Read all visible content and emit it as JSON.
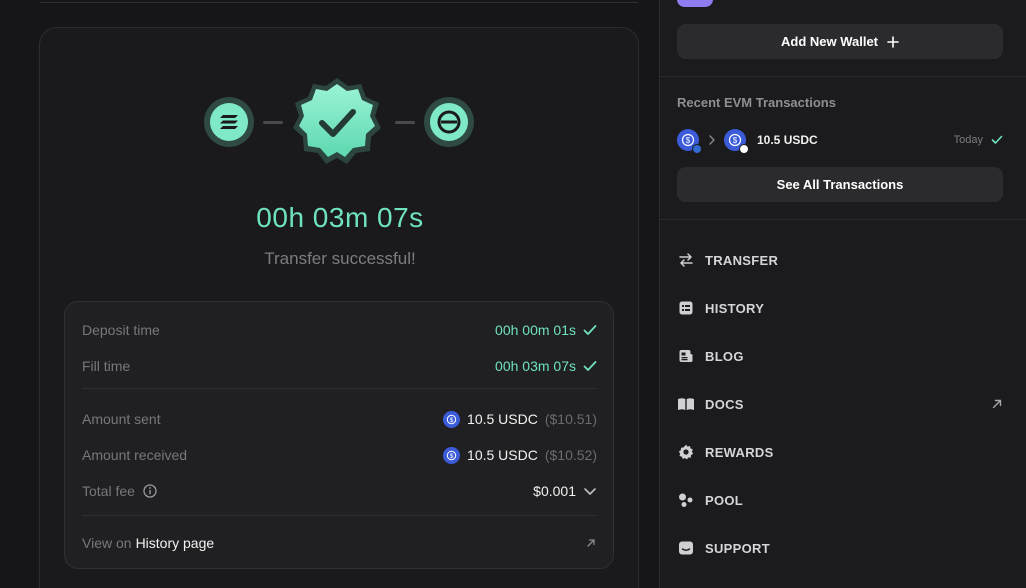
{
  "transfer": {
    "timer": "00h 03m 07s",
    "status": "Transfer successful!",
    "details": {
      "deposit_label": "Deposit time",
      "deposit_value": "00h 00m 01s",
      "fill_label": "Fill time",
      "fill_value": "00h 03m 07s",
      "sent_label": "Amount sent",
      "sent_value": "10.5 USDC",
      "sent_usd": "($10.51)",
      "received_label": "Amount received",
      "received_value": "10.5 USDC",
      "received_usd": "($10.52)",
      "fee_label": "Total fee",
      "fee_value": "$0.001",
      "view_prefix": "View on",
      "view_link": "History page"
    }
  },
  "sidebar": {
    "add_wallet_label": "Add New Wallet",
    "recent_title": "Recent EVM Transactions",
    "recent_tx": {
      "amount": "10.5 USDC",
      "when": "Today"
    },
    "see_all_label": "See All Transactions",
    "nav": [
      {
        "label": "TRANSFER",
        "icon": "arrows-swap-icon"
      },
      {
        "label": "HISTORY",
        "icon": "list-icon"
      },
      {
        "label": "BLOG",
        "icon": "newspaper-icon"
      },
      {
        "label": "DOCS",
        "icon": "book-icon"
      },
      {
        "label": "REWARDS",
        "icon": "gear-icon"
      },
      {
        "label": "POOL",
        "icon": "pool-icon"
      },
      {
        "label": "SUPPORT",
        "icon": "chat-icon"
      }
    ]
  },
  "colors": {
    "accent": "#6fe3bd",
    "usdc": "#3b5bd9",
    "background": "#161618"
  }
}
